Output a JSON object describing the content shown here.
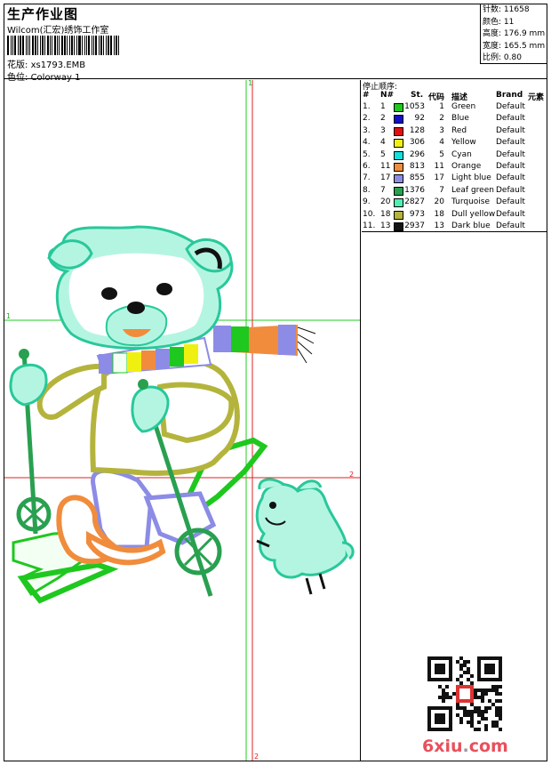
{
  "header": {
    "title": "生产作业图",
    "company": "Wilcom(汇宏)绣饰工作室",
    "file_label": "花版:",
    "file_name": "xs1793.EMB",
    "colorway_label": "色位:",
    "colorway": "Colorway 1"
  },
  "stats": {
    "stitches_label": "针数:",
    "stitches": "11658",
    "colors_label": "颜色:",
    "colors": "11",
    "height_label": "高度:",
    "height": "176.9 mm",
    "width_label": "宽度:",
    "width": "165.5 mm",
    "scale_label": "比例:",
    "scale": "0.80"
  },
  "design": {
    "guide_labels": {
      "left": "1",
      "right": "2",
      "top": "1",
      "bottom": "2"
    }
  },
  "table": {
    "title": "停止顺序:",
    "headers": {
      "seq": "#",
      "no": "N#",
      "stitches": "St.",
      "code": "代码",
      "desc": "描述",
      "brand": "Brand",
      "elem": "元素"
    },
    "rows": [
      {
        "seq": "1.",
        "no": "1",
        "color": "#1ec81e",
        "stitches": "1053",
        "code": "1",
        "desc": "Green",
        "brand": "Default"
      },
      {
        "seq": "2.",
        "no": "2",
        "color": "#1010c8",
        "stitches": "92",
        "code": "2",
        "desc": "Blue",
        "brand": "Default"
      },
      {
        "seq": "3.",
        "no": "3",
        "color": "#e01010",
        "stitches": "128",
        "code": "3",
        "desc": "Red",
        "brand": "Default"
      },
      {
        "seq": "4.",
        "no": "4",
        "color": "#f0f010",
        "stitches": "306",
        "code": "4",
        "desc": "Yellow",
        "brand": "Default"
      },
      {
        "seq": "5.",
        "no": "5",
        "color": "#10e0e0",
        "stitches": "296",
        "code": "5",
        "desc": "Cyan",
        "brand": "Default"
      },
      {
        "seq": "6.",
        "no": "11",
        "color": "#f08c3c",
        "stitches": "813",
        "code": "11",
        "desc": "Orange",
        "brand": "Default"
      },
      {
        "seq": "7.",
        "no": "17",
        "color": "#8c8ce6",
        "stitches": "855",
        "code": "17",
        "desc": "Light blue",
        "brand": "Default"
      },
      {
        "seq": "8.",
        "no": "7",
        "color": "#28a050",
        "stitches": "1376",
        "code": "7",
        "desc": "Leaf green",
        "brand": "Default"
      },
      {
        "seq": "9.",
        "no": "20",
        "color": "#50f0b4",
        "stitches": "2827",
        "code": "20",
        "desc": "Turquoise",
        "brand": "Default"
      },
      {
        "seq": "10.",
        "no": "18",
        "color": "#b4b43c",
        "stitches": "973",
        "code": "18",
        "desc": "Dull yellow",
        "brand": "Default"
      },
      {
        "seq": "11.",
        "no": "13",
        "color": "#141414",
        "stitches": "2937",
        "code": "13",
        "desc": "Dark blue",
        "brand": "Default"
      }
    ]
  },
  "watermark": {
    "text": "6xiu",
    "dot": ".",
    "tld": "com"
  }
}
